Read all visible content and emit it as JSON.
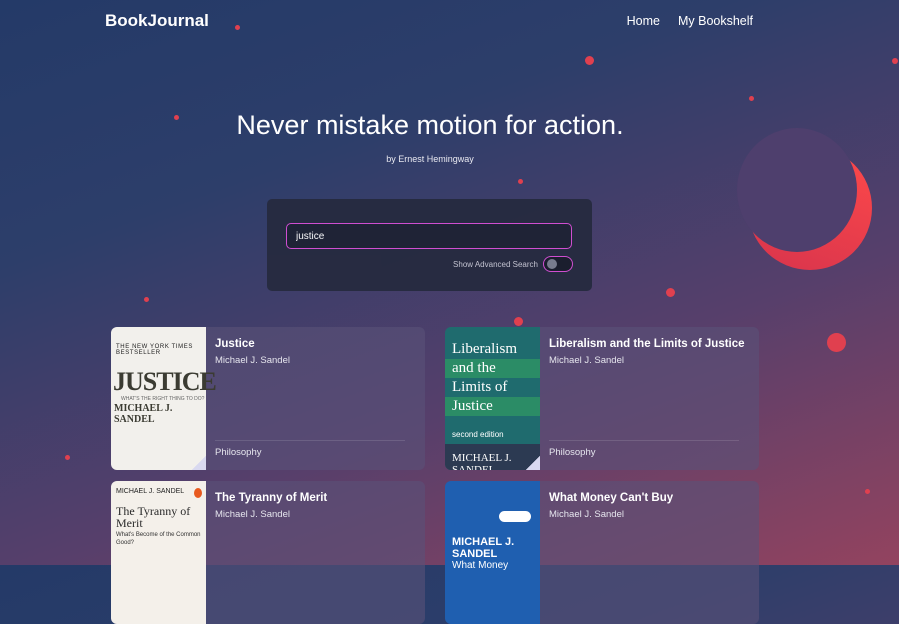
{
  "nav": {
    "brand": "BookJournal",
    "links": [
      "Home",
      "My Bookshelf"
    ]
  },
  "hero": {
    "quote": "Never mistake motion for action.",
    "author": "by Ernest Hemingway"
  },
  "search": {
    "value": "justice",
    "advanced_label": "Show Advanced Search",
    "advanced_enabled": false
  },
  "books": [
    {
      "title": "Justice",
      "author": "Michael J. Sandel",
      "category": "Philosophy",
      "cover": {
        "top": "THE NEW YORK TIMES BESTSELLER",
        "title": "JUSTICE",
        "subtitle": "WHAT'S THE RIGHT THING TO DO?",
        "author": "MICHAEL J. SANDEL"
      }
    },
    {
      "title": "Liberalism and the Limits of Justice",
      "author": "Michael J. Sandel",
      "category": "Philosophy",
      "cover": {
        "lines": [
          "Liberalism",
          "and the",
          "Limits of",
          "Justice"
        ],
        "edition": "second edition",
        "author": "MICHAEL J. SANDEL"
      }
    },
    {
      "title": "The Tyranny of Merit",
      "author": "Michael J. Sandel",
      "category": "",
      "cover": {
        "author": "MICHAEL J. SANDEL",
        "title": "The Tyranny of Merit",
        "subtitle": "What's Become of the Common Good?"
      }
    },
    {
      "title": "What Money Can't Buy",
      "author": "Michael J. Sandel",
      "category": "",
      "cover": {
        "author": "MICHAEL J. SANDEL",
        "title": "What Money"
      }
    }
  ],
  "colors": {
    "accent": "#d64fd6",
    "dots": "#e0404f",
    "moon": "#ff4a4a",
    "panel": "#262b40"
  }
}
